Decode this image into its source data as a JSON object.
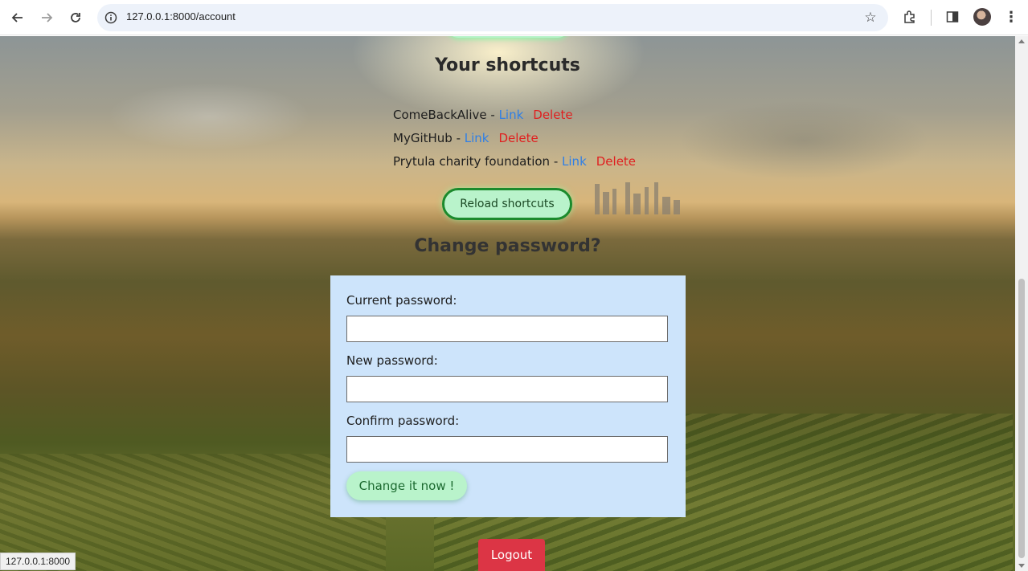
{
  "browser": {
    "url": "127.0.0.1:8000/account",
    "status_url": "127.0.0.1:8000"
  },
  "shortcuts": {
    "heading": "Your shortcuts",
    "items": [
      {
        "name": "ComeBackAlive",
        "separator": " - ",
        "link_label": "Link",
        "delete_label": "Delete"
      },
      {
        "name": "MyGitHub",
        "separator": " - ",
        "link_label": "Link",
        "delete_label": "Delete"
      },
      {
        "name": "Prytula charity foundation",
        "separator": " - ",
        "link_label": "Link",
        "delete_label": "Delete"
      }
    ],
    "reload_label": "Reload shortcuts"
  },
  "password": {
    "heading": "Change password?",
    "current_label": "Current password:",
    "new_label": "New password:",
    "confirm_label": "Confirm password:",
    "submit_label": "Change it now !"
  },
  "logout_label": "Logout"
}
